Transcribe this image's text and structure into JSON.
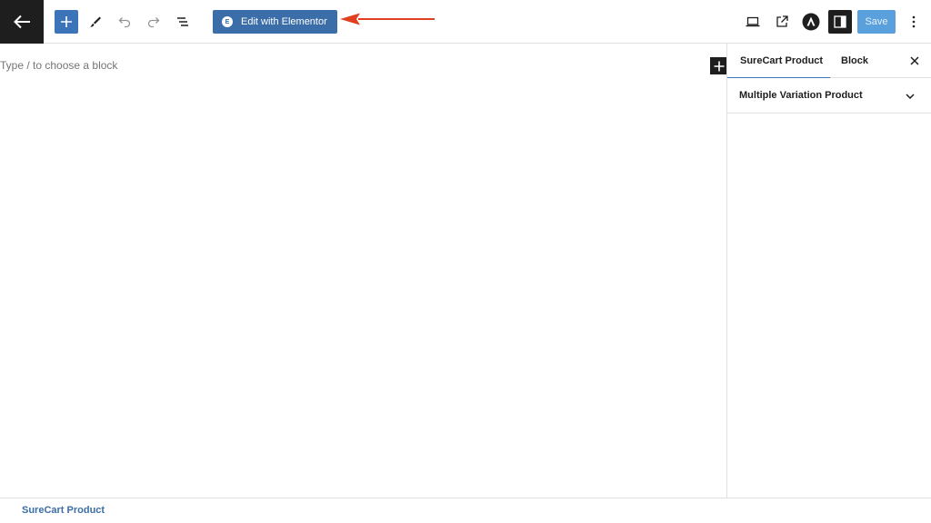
{
  "toolbar": {
    "back_icon": "arrow-left-icon",
    "inserter_icon": "plus-icon",
    "tools_icon": "brush-icon",
    "undo_icon": "undo-icon",
    "redo_icon": "redo-icon",
    "list_view_icon": "list-view-icon",
    "elementor_label": "Edit with Elementor",
    "elementor_logo": "E",
    "preview_icon": "laptop-icon",
    "view_post_icon": "external-link-icon",
    "astra_icon": "astra-logo-icon",
    "settings_icon": "sidebar-toggle-icon",
    "save_label": "Save",
    "options_icon": "kebab-menu-icon"
  },
  "canvas": {
    "placeholder": "Type / to choose a block",
    "block_inserter_icon": "plus-icon"
  },
  "sidebar": {
    "tabs": [
      {
        "label": "SureCart Product",
        "active": true
      },
      {
        "label": "Block",
        "active": false
      }
    ],
    "close_icon": "close-icon",
    "panel_title": "Multiple Variation Product",
    "panel_icon": "chevron-down-icon"
  },
  "footer": {
    "breadcrumb": "SureCart Product"
  },
  "colors": {
    "accent": "#3b74b8",
    "elementor_button": "#3b6ea8",
    "annotation_arrow": "#e0401f",
    "save_disabled": "#5aa0dc"
  }
}
